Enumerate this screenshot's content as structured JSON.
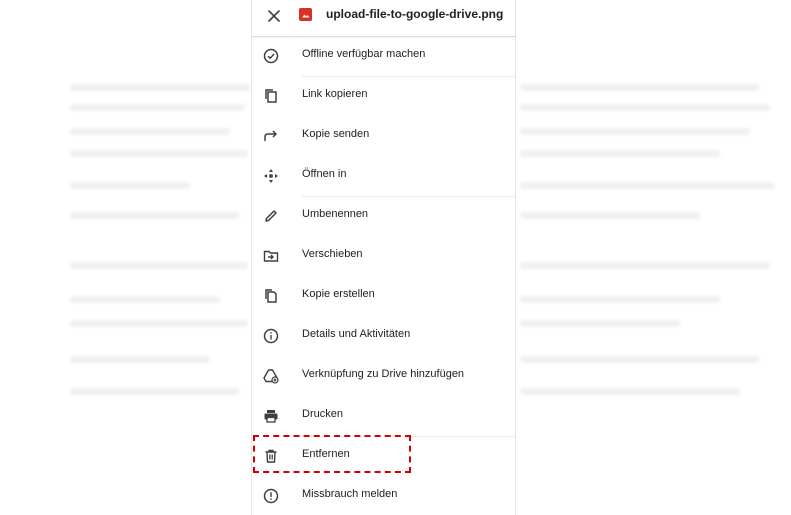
{
  "header": {
    "close_icon": "close-icon",
    "file_icon": "image-file-icon",
    "file_icon_color": "#d93025",
    "file_name": "upload-file-to-google-drive.png"
  },
  "menu": {
    "items": [
      {
        "label": "Offline verfügbar machen",
        "icon": "offline-check-icon"
      },
      {
        "label": "Link kopieren",
        "icon": "copy-link-icon"
      },
      {
        "label": "Kopie senden",
        "icon": "send-arrow-icon"
      },
      {
        "label": "Öffnen in",
        "icon": "open-in-move-icon"
      },
      {
        "label": "Umbenennen",
        "icon": "pencil-icon"
      },
      {
        "label": "Verschieben",
        "icon": "move-folder-icon"
      },
      {
        "label": "Kopie erstellen",
        "icon": "duplicate-icon"
      },
      {
        "label": "Details und Aktivitäten",
        "icon": "info-icon"
      },
      {
        "label": "Verknüpfung zu Drive hinzufügen",
        "icon": "drive-shortcut-icon"
      },
      {
        "label": "Drucken",
        "icon": "printer-icon"
      },
      {
        "label": "Entfernen",
        "icon": "trash-icon"
      },
      {
        "label": "Missbrauch melden",
        "icon": "report-icon"
      }
    ]
  },
  "highlight": {
    "target": "Entfernen",
    "color": "#d40000"
  }
}
